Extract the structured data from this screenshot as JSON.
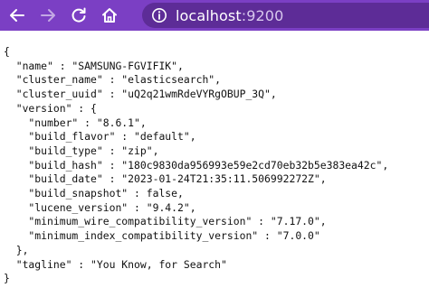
{
  "browser": {
    "url_host": "localhost",
    "url_port": ":9200",
    "icons": {
      "back": "arrow-left-icon",
      "forward": "arrow-right-icon",
      "reload": "reload-icon",
      "home": "home-icon",
      "site_info": "info-circle-icon"
    },
    "toolbar_color": "#7b3fc4",
    "urlbar_color": "#5d2c97"
  },
  "response_lines": [
    "{",
    "  \"name\" : \"SAMSUNG-FGVIFIK\",",
    "  \"cluster_name\" : \"elasticsearch\",",
    "  \"cluster_uuid\" : \"uQ2q21wmRdeVYRgOBUP_3Q\",",
    "  \"version\" : {",
    "    \"number\" : \"8.6.1\",",
    "    \"build_flavor\" : \"default\",",
    "    \"build_type\" : \"zip\",",
    "    \"build_hash\" : \"180c9830da956993e59e2cd70eb32b5e383ea42c\",",
    "    \"build_date\" : \"2023-01-24T21:35:11.506992272Z\",",
    "    \"build_snapshot\" : false,",
    "    \"lucene_version\" : \"9.4.2\",",
    "    \"minimum_wire_compatibility_version\" : \"7.17.0\",",
    "    \"minimum_index_compatibility_version\" : \"7.0.0\"",
    "  },",
    "  \"tagline\" : \"You Know, for Search\"",
    "}"
  ]
}
